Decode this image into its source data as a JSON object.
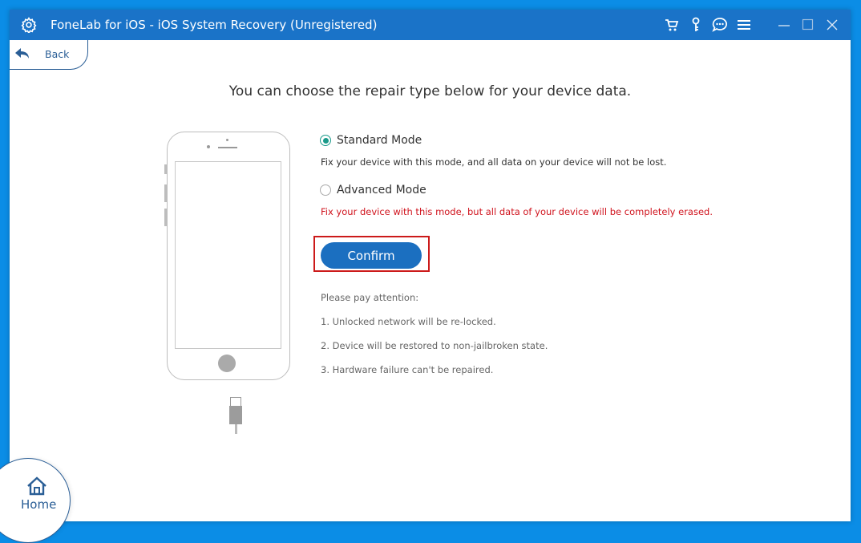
{
  "window": {
    "title": "FoneLab for iOS - iOS System Recovery (Unregistered)",
    "title_icons": [
      "settings-gear-icon"
    ],
    "toolbar_icons": [
      "cart-icon",
      "key-icon",
      "chat-icon",
      "menu-icon"
    ],
    "window_controls": [
      "minimize-icon",
      "maximize-icon",
      "close-icon"
    ],
    "accent_color": "#1a73c8"
  },
  "nav": {
    "back_label": "Back",
    "home_label": "Home"
  },
  "main": {
    "heading": "You can choose the repair type below for your device data.",
    "modes": [
      {
        "label": "Standard Mode",
        "selected": true,
        "description": "Fix your device with this mode, and all data on your device will not be lost."
      },
      {
        "label": "Advanced Mode",
        "selected": false,
        "description": "Fix your device with this mode, but all data of your device will be completely erased."
      }
    ],
    "confirm_label": "Confirm",
    "notes_title": "Please pay attention:",
    "notes": [
      "1. Unlocked network will be re-locked.",
      "2. Device will be restored to non-jailbroken state.",
      "3. Hardware failure can't be repaired."
    ],
    "warning_color": "#d0141e"
  }
}
